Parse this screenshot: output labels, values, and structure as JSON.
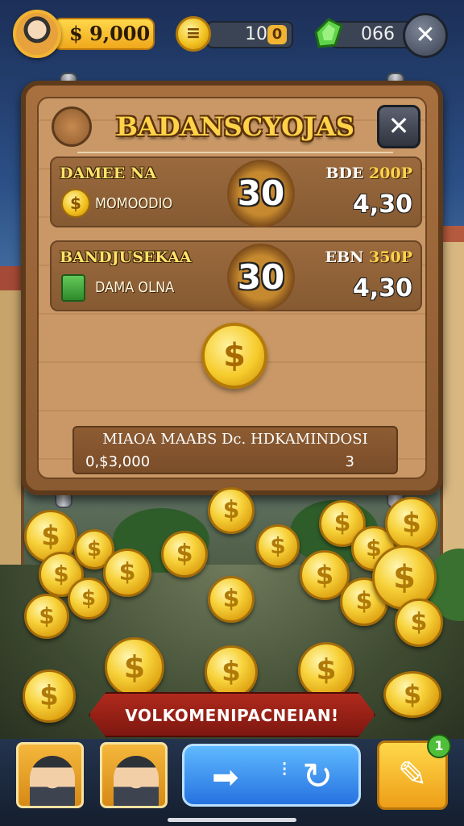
{
  "topbar": {
    "money": "$ 9,000",
    "coin_icon_glyph": "≡",
    "coins": "10",
    "coins_badge": "0",
    "gems": "066",
    "settings_glyph": "✕"
  },
  "panel": {
    "title": "BADANSCYOJAS",
    "close_glyph": "✕",
    "rows": [
      {
        "label": "DAMEE NA",
        "sub": "MOMOODIO",
        "big": "30",
        "right_top_a": "BDE",
        "right_top_b": "200P",
        "right_big": "4,30",
        "icon": "coin"
      },
      {
        "label": "BANDJUSEKAA",
        "sub": "DAMA OLNA",
        "big": "30",
        "right_top_a": "EBN",
        "right_top_b": "350P",
        "right_big": "4,30",
        "icon": "cash"
      }
    ],
    "center_coin_glyph": "$",
    "footer": {
      "title": "MIAOA MAABS Dc. HDKAMINDOSI",
      "left": "0,$3,000",
      "right": "3"
    }
  },
  "banner": "VOLKOMENIPACNEIAN!",
  "bottom": {
    "play_arrow": "➡",
    "play_pin": "⁝",
    "play_refresh": "↻",
    "tool_glyph": "✎",
    "tool_badge": "1"
  },
  "colors": {
    "gold": "#ffd24a",
    "wood": "#c99866",
    "banner_red": "#b02a1c",
    "play_blue": "#2672e0"
  }
}
